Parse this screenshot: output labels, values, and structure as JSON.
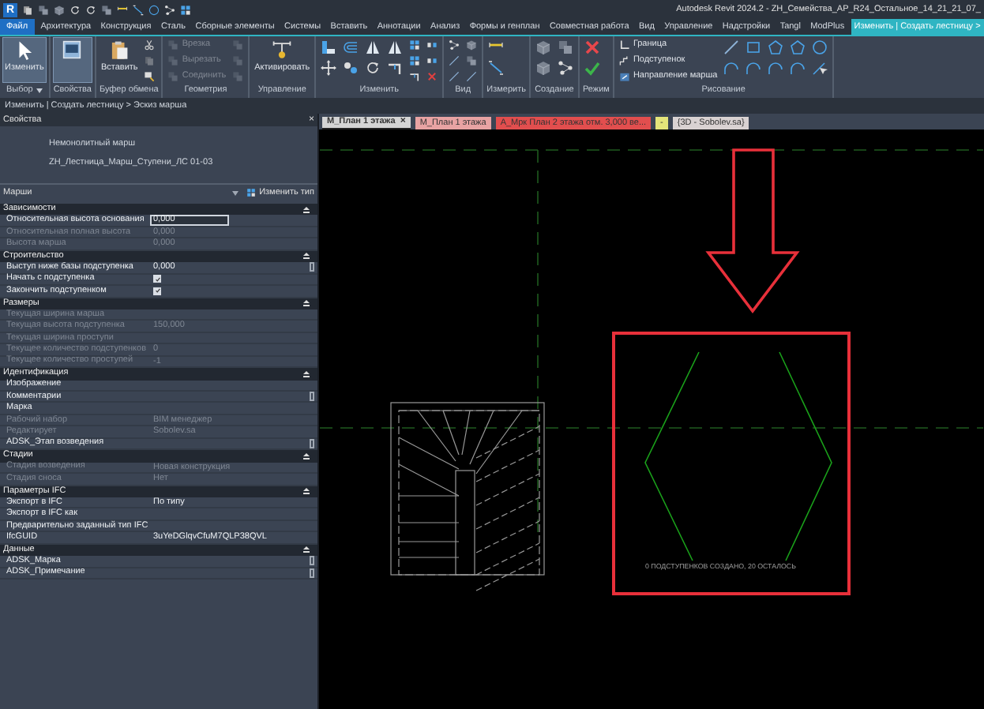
{
  "title_bar": {
    "logo": "R",
    "title": "Autodesk Revit 2024.2 - ZH_Семейства_АР_R24_Остальное_14_21_21_07_"
  },
  "menu_tabs": [
    {
      "label": "Файл",
      "kind": "file",
      "selected": false
    },
    {
      "label": "Архитектура",
      "kind": "tab",
      "selected": false
    },
    {
      "label": "Конструкция",
      "kind": "tab",
      "selected": false
    },
    {
      "label": "Сталь",
      "kind": "tab",
      "selected": false
    },
    {
      "label": "Сборные элементы",
      "kind": "tab",
      "selected": false
    },
    {
      "label": "Системы",
      "kind": "tab",
      "selected": false
    },
    {
      "label": "Вставить",
      "kind": "tab",
      "selected": false
    },
    {
      "label": "Аннотации",
      "kind": "tab",
      "selected": false
    },
    {
      "label": "Анализ",
      "kind": "tab",
      "selected": false
    },
    {
      "label": "Формы и генплан",
      "kind": "tab",
      "selected": false
    },
    {
      "label": "Совместная работа",
      "kind": "tab",
      "selected": false
    },
    {
      "label": "Вид",
      "kind": "tab",
      "selected": false
    },
    {
      "label": "Управление",
      "kind": "tab",
      "selected": false
    },
    {
      "label": "Надстройки",
      "kind": "tab",
      "selected": false
    },
    {
      "label": "Tangl",
      "kind": "tab",
      "selected": false
    },
    {
      "label": "ModPlus",
      "kind": "tab",
      "selected": false
    },
    {
      "label": "Изменить | Создать лестницу >",
      "kind": "tab",
      "selected": true
    }
  ],
  "ribbon": {
    "panels": [
      {
        "title": "Выбор",
        "menu": true,
        "tools": [
          {
            "kind": "large",
            "label": "Изменить",
            "selected": true,
            "disabled": false
          }
        ]
      },
      {
        "title": "Свойства",
        "menu": false,
        "tools": [
          {
            "kind": "large",
            "selected": true,
            "disabled": false
          }
        ]
      },
      {
        "title": "Буфер обмена",
        "menu": false,
        "tools": [
          {
            "kind": "large",
            "label": "Вставить",
            "selected": false,
            "disabled": false
          },
          {
            "kind": "small",
            "selected": false,
            "disabled": false
          },
          {
            "kind": "small",
            "selected": false,
            "disabled": true
          },
          {
            "kind": "small",
            "selected": false,
            "disabled": false
          }
        ]
      },
      {
        "title": "Геометрия",
        "menu": false,
        "tools": [
          {
            "kind": "small",
            "label": "Врезка",
            "selected": false,
            "disabled": true
          },
          {
            "kind": "small",
            "label": "Вырезать",
            "selected": false,
            "disabled": true
          },
          {
            "kind": "small",
            "label": "Соединить",
            "selected": false,
            "disabled": true
          },
          {
            "kind": "small",
            "selected": false,
            "disabled": true
          },
          {
            "kind": "small",
            "selected": false,
            "disabled": true
          },
          {
            "kind": "small",
            "selected": false,
            "disabled": true
          }
        ]
      },
      {
        "title": "Управление",
        "menu": false,
        "tools": [
          {
            "kind": "large",
            "label": "Активировать",
            "selected": false,
            "disabled": false
          }
        ]
      },
      {
        "title": "Изменить",
        "menu": false,
        "tools": [
          {
            "kind": "icon",
            "selected": false,
            "disabled": false
          },
          {
            "kind": "icon",
            "selected": false,
            "disabled": false
          },
          {
            "kind": "icon",
            "selected": false,
            "disabled": false
          },
          {
            "kind": "icon",
            "selected": false,
            "disabled": false
          },
          {
            "kind": "icon",
            "selected": false,
            "disabled": false
          },
          {
            "kind": "icon",
            "selected": false,
            "disabled": false
          },
          {
            "kind": "icon",
            "selected": false,
            "disabled": false
          },
          {
            "kind": "icon",
            "selected": false,
            "disabled": false
          },
          {
            "kind": "small",
            "selected": false,
            "disabled": false
          },
          {
            "kind": "small",
            "selected": false,
            "disabled": false
          },
          {
            "kind": "small",
            "selected": false,
            "disabled": false
          },
          {
            "kind": "small",
            "selected": false,
            "disabled": false
          },
          {
            "kind": "small",
            "selected": false,
            "disabled": false
          },
          {
            "kind": "small",
            "selected": false,
            "disabled": false
          }
        ]
      },
      {
        "title": "Вид",
        "menu": false,
        "tools": [
          {
            "kind": "small",
            "selected": false,
            "disabled": false
          },
          {
            "kind": "small",
            "selected": false,
            "disabled": false
          },
          {
            "kind": "small",
            "selected": false,
            "disabled": false
          },
          {
            "kind": "small",
            "selected": false,
            "disabled": false
          },
          {
            "kind": "small",
            "selected": false,
            "disabled": false
          },
          {
            "kind": "small",
            "selected": false,
            "disabled": false
          }
        ]
      },
      {
        "title": "Измерить",
        "menu": false,
        "tools": [
          {
            "kind": "icon",
            "selected": false,
            "disabled": false
          },
          {
            "kind": "icon",
            "selected": false,
            "disabled": false
          }
        ]
      },
      {
        "title": "Создание",
        "menu": false,
        "tools": [
          {
            "kind": "icon",
            "selected": false,
            "disabled": false
          },
          {
            "kind": "icon",
            "selected": false,
            "disabled": false
          },
          {
            "kind": "icon",
            "selected": false,
            "disabled": false
          },
          {
            "kind": "icon",
            "selected": false,
            "disabled": false
          }
        ]
      },
      {
        "title": "Режим",
        "menu": false,
        "tools": [
          {
            "kind": "icon",
            "selected": false,
            "disabled": false
          },
          {
            "kind": "icon",
            "selected": false,
            "disabled": false
          }
        ]
      },
      {
        "title": "Рисование",
        "menu": false,
        "tools": [
          {
            "kind": "small",
            "label": "Граница",
            "selected": false,
            "disabled": false
          },
          {
            "kind": "small",
            "label": "Подступенок",
            "selected": false,
            "disabled": false
          },
          {
            "kind": "small",
            "label": "Направление марша",
            "selected": false,
            "disabled": false
          },
          {
            "kind": "icon",
            "selected": false,
            "disabled": false
          },
          {
            "kind": "icon",
            "selected": false,
            "disabled": false
          },
          {
            "kind": "icon",
            "selected": false,
            "disabled": false
          },
          {
            "kind": "icon",
            "selected": false,
            "disabled": false
          },
          {
            "kind": "icon",
            "selected": false,
            "disabled": false
          },
          {
            "kind": "icon",
            "selected": false,
            "disabled": false
          },
          {
            "kind": "icon",
            "selected": false,
            "disabled": false
          },
          {
            "kind": "icon",
            "selected": false,
            "disabled": false
          },
          {
            "kind": "icon",
            "selected": false,
            "disabled": false
          },
          {
            "kind": "icon",
            "selected": false,
            "disabled": false
          }
        ]
      }
    ]
  },
  "context_bar": {
    "text": "Изменить | Создать лестницу > Эскиз марша"
  },
  "properties": {
    "title": "Свойства",
    "close": "×",
    "type_name": "Немонолитный марш",
    "type_family": "ZH_Лестница_Марш_Ступени_ЛС 01-03",
    "filter": "Марши",
    "edit_type": "Изменить тип",
    "groups": [
      {
        "title": "Зависимости",
        "rows": [
          {
            "label": "Относительная высота основания",
            "value": "0,000",
            "kind": "input",
            "disabled": false,
            "linked": false
          },
          {
            "label": "Относительная полная высота",
            "value": "0,000",
            "kind": "text",
            "disabled": true,
            "linked": false
          },
          {
            "label": "Высота марша",
            "value": "0,000",
            "kind": "text",
            "disabled": true,
            "linked": false
          }
        ]
      },
      {
        "title": "Строительство",
        "rows": [
          {
            "label": "Выступ ниже базы подступенка",
            "value": "0,000",
            "kind": "text",
            "disabled": false,
            "linked": true
          },
          {
            "label": "Начать с подступенка",
            "checked": true,
            "kind": "checkbox",
            "disabled": false,
            "linked": false
          },
          {
            "label": "Закончить подступенком",
            "checked": true,
            "kind": "checkbox",
            "disabled": false,
            "linked": false
          }
        ]
      },
      {
        "title": "Размеры",
        "rows": [
          {
            "label": "Текущая ширина марша",
            "kind": "text",
            "disabled": true,
            "linked": false
          },
          {
            "label": "Текущая высота подступенка",
            "value": "150,000",
            "kind": "text",
            "disabled": true,
            "linked": false
          },
          {
            "label": "Текущая ширина проступи",
            "kind": "text",
            "disabled": true,
            "linked": false
          },
          {
            "label": "Текущее количество подступенков",
            "value": "0",
            "kind": "text",
            "disabled": true,
            "linked": false
          },
          {
            "label": "Текущее количество проступей",
            "value": "-1",
            "kind": "text",
            "disabled": true,
            "linked": false
          }
        ]
      },
      {
        "title": "Идентификация",
        "rows": [
          {
            "label": "Изображение",
            "kind": "text",
            "disabled": false,
            "linked": false
          },
          {
            "label": "Комментарии",
            "kind": "text",
            "disabled": false,
            "linked": true
          },
          {
            "label": "Марка",
            "kind": "text",
            "disabled": false,
            "linked": false
          },
          {
            "label": "Рабочий набор",
            "value": "BIM менеджер",
            "kind": "text",
            "disabled": true,
            "linked": false
          },
          {
            "label": "Редактирует",
            "value": "Sobolev.sa",
            "kind": "text",
            "disabled": true,
            "linked": false
          },
          {
            "label": "ADSK_Этап возведения",
            "kind": "text",
            "disabled": false,
            "linked": true
          }
        ]
      },
      {
        "title": "Стадии",
        "rows": [
          {
            "label": "Стадия возведения",
            "value": "Новая конструкция",
            "kind": "text",
            "disabled": true,
            "linked": false
          },
          {
            "label": "Стадия сноса",
            "value": "Нет",
            "kind": "text",
            "disabled": true,
            "linked": false
          }
        ]
      },
      {
        "title": "Параметры IFC",
        "rows": [
          {
            "label": "Экспорт в IFC",
            "value": "По типу",
            "kind": "text",
            "disabled": false,
            "linked": false
          },
          {
            "label": "Экспорт в IFC как",
            "kind": "text",
            "disabled": false,
            "linked": false
          },
          {
            "label": "Предварительно заданный тип IFC",
            "kind": "text",
            "disabled": false,
            "linked": false
          },
          {
            "label": "IfcGUID",
            "value": "3uYeDGlqvCfuM7QLP38QVL",
            "kind": "text",
            "disabled": false,
            "linked": false
          }
        ]
      },
      {
        "title": "Данные",
        "rows": [
          {
            "label": "ADSK_Марка",
            "kind": "text",
            "disabled": false,
            "linked": true
          },
          {
            "label": "ADSK_Примечание",
            "kind": "text",
            "disabled": false,
            "linked": true
          }
        ]
      }
    ]
  },
  "view_tabs": [
    {
      "label": "M_План 1 этажа",
      "close": "×",
      "selected": true,
      "color": "#d4d4d4"
    },
    {
      "label": "M_План 1 этажа",
      "selected": false,
      "color": "#e8a3a3"
    },
    {
      "label": "A_Мрк План 2 этажа отм. 3,000 ве...",
      "selected": false,
      "color": "#e24e4e"
    },
    {
      "label": "-",
      "selected": false,
      "color": "#e4e47a"
    },
    {
      "label": "{3D - Sobolev.sa}",
      "selected": false,
      "color": "#d9d2d2"
    }
  ],
  "canvas": {
    "message": "0 ПОДСТУПЕНКОВ СОЗДАНО, 20 ОСТАЛОСЬ"
  }
}
